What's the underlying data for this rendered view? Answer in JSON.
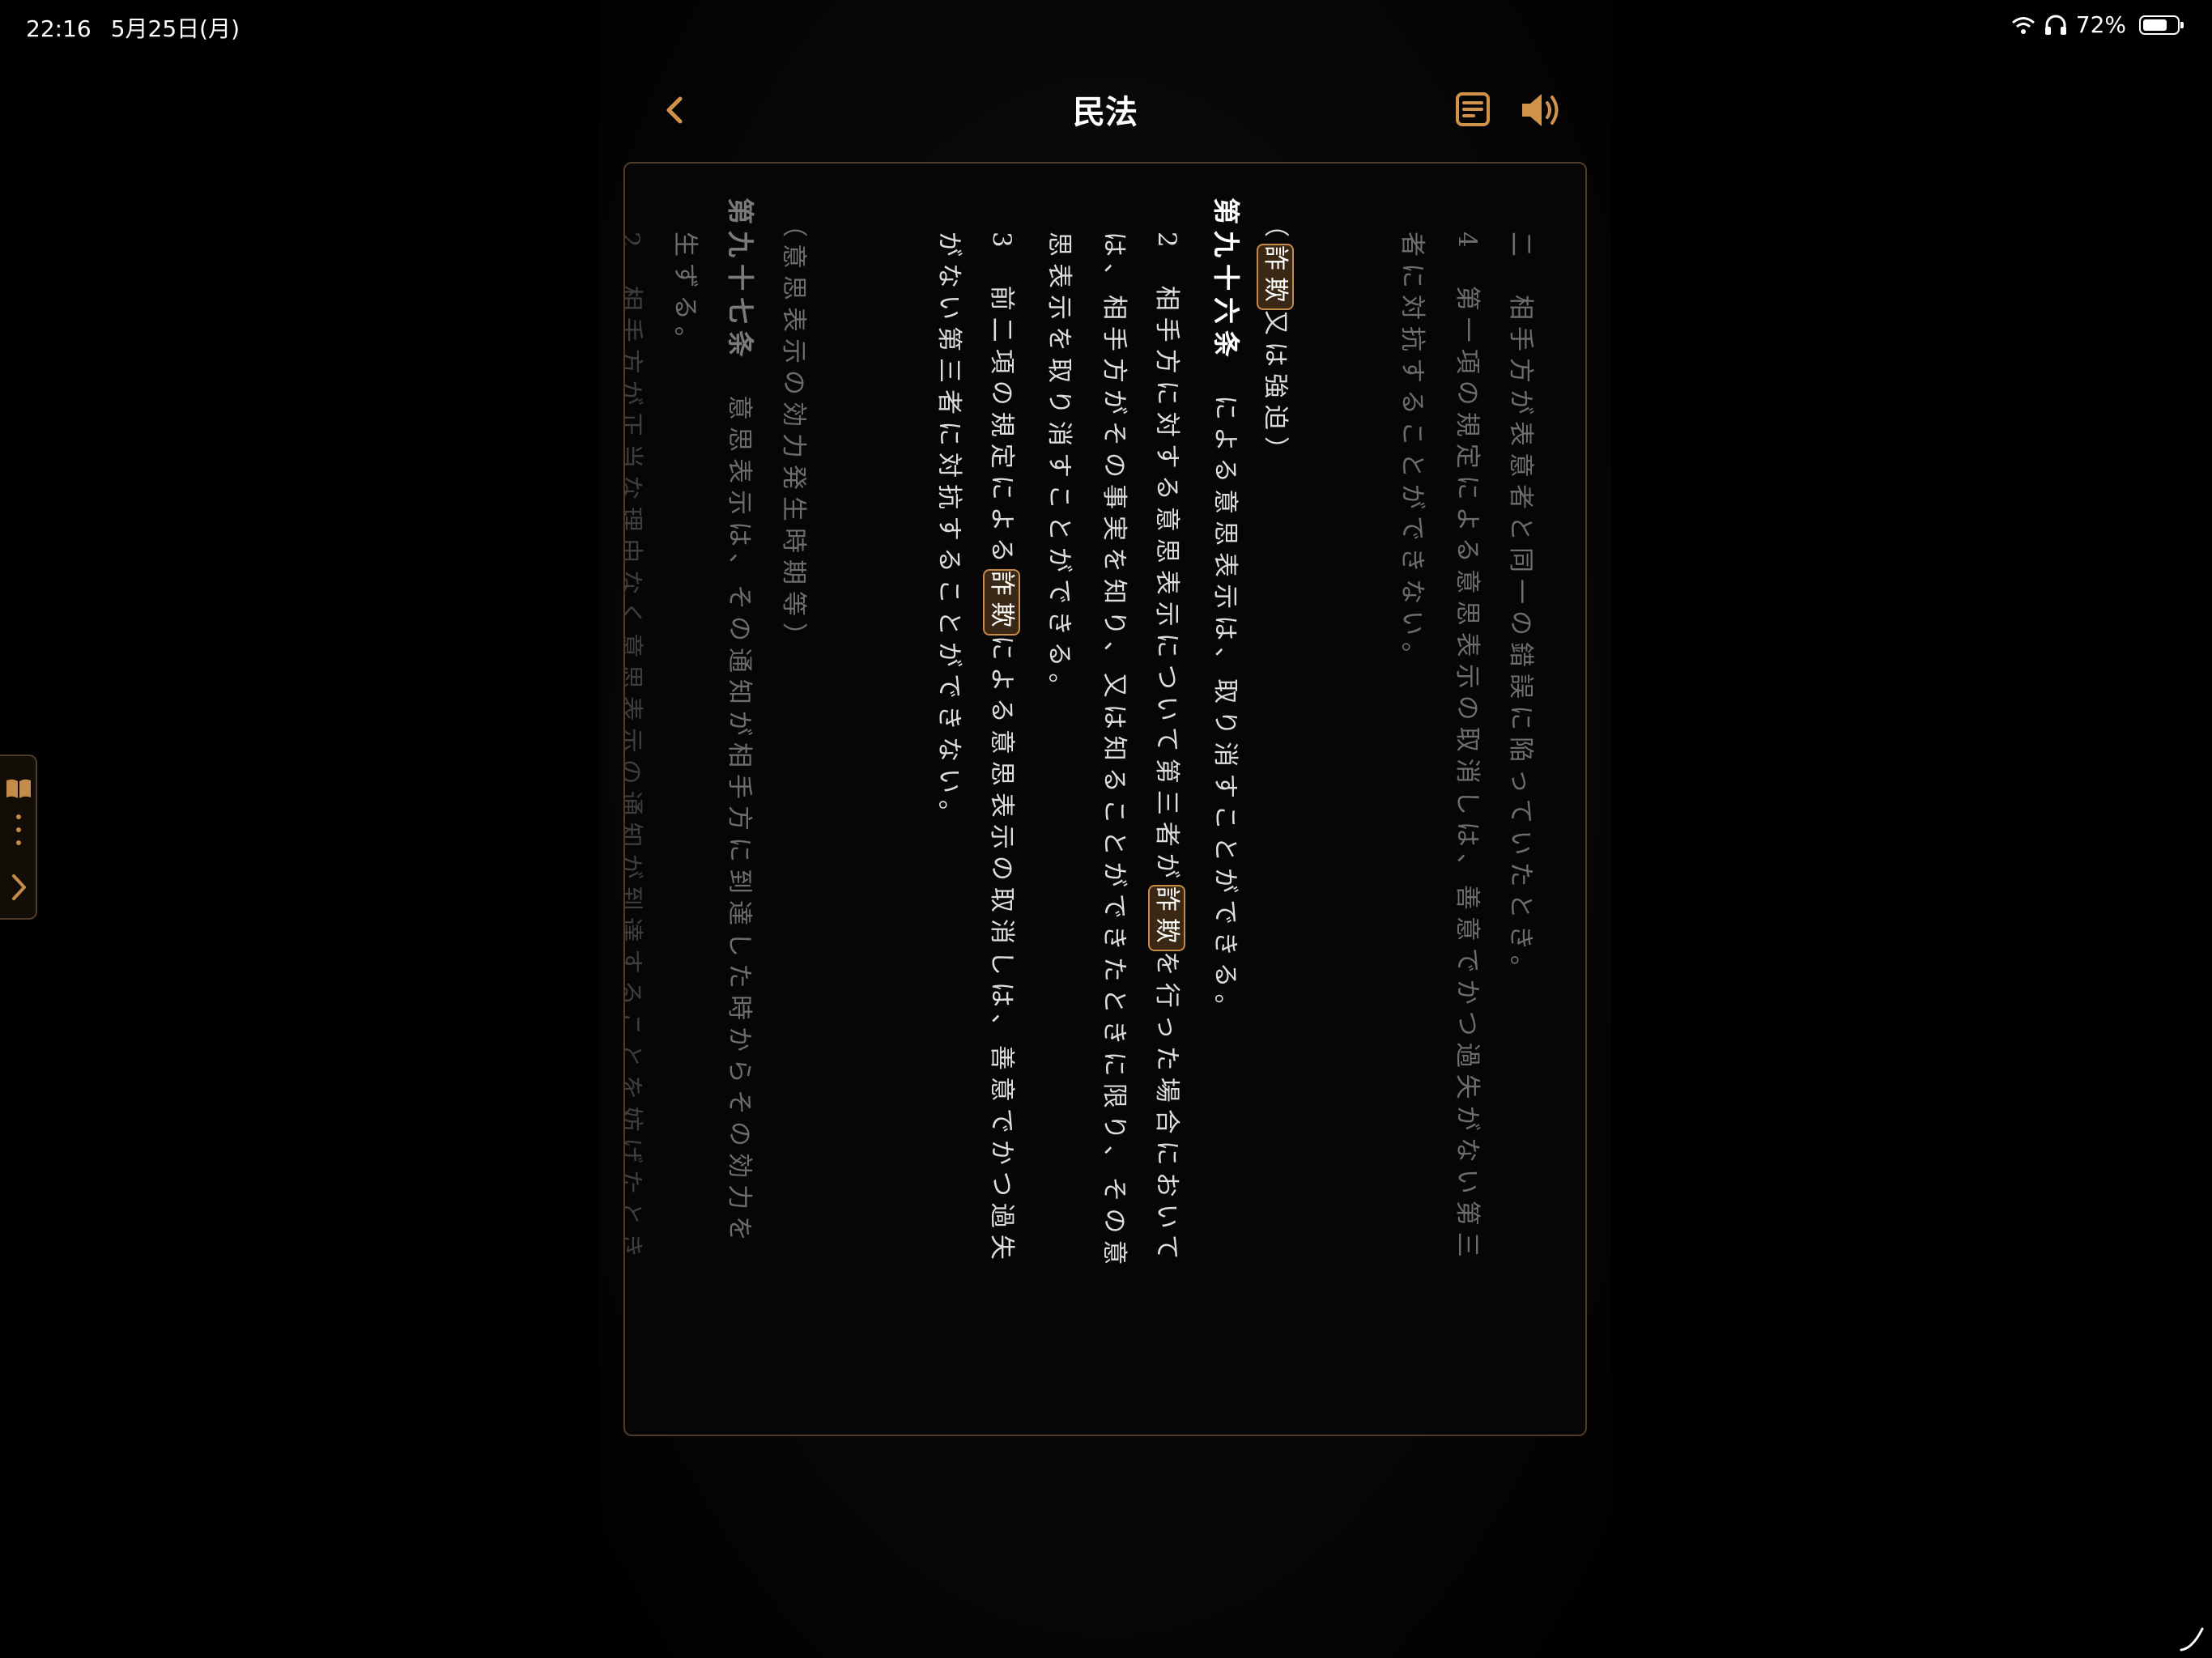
{
  "status_bar": {
    "time": "22:16",
    "date": "5月25日(月)",
    "battery": "72%",
    "battery_level": 0.72
  },
  "header": {
    "title": "民法"
  },
  "page": {
    "prev_item4_part1": "二　相手方が表意者と同一の錯誤に陥っていたとき。",
    "prev_item4_part2": "4　第一項の規定による意思表示の取消しは、善意でかつ過失がない第三",
    "prev_item4_part3": "者に対抗することができない。",
    "a96_heading_open": "（",
    "a96_heading_hl": "詐欺",
    "a96_heading_rest": "又は強迫）",
    "a96_number": "第九十六条",
    "a96_p1": "による意思表示は、取り消すことができる。",
    "a96_p2_pre": "2　相手方に対する意思表示について第三者が",
    "a96_p2_hl": "詐欺",
    "a96_p2_post": "を行った場合において",
    "a96_p2_l2": "は、相手方がその事実を知り、又は知ることができたときに限り、その意",
    "a96_p2_l3": "思表示を取り消すことができる。",
    "a96_p3_pre": "3　前二項の規定による",
    "a96_p3_hl": "詐欺",
    "a96_p3_post": "による意思表示の取消しは、善意でかつ過失",
    "a96_p3_l2": "がない第三者に対抗することができない。",
    "a97_heading": "（意思表示の効力発生時期等）",
    "a97_number": "第九十七条",
    "a97_p1": "意思表示は、その通知が相手方に到達した時からその効力を",
    "a97_p1_l2": "生ずる。",
    "a97_p2": "2　相手方が正当な理由なく意思表示の通知が到達することを妨げたとき"
  },
  "icons": {
    "accent": "#d2924a",
    "back": "chevron-left-icon",
    "note": "note-icon",
    "sound": "speaker-icon"
  }
}
